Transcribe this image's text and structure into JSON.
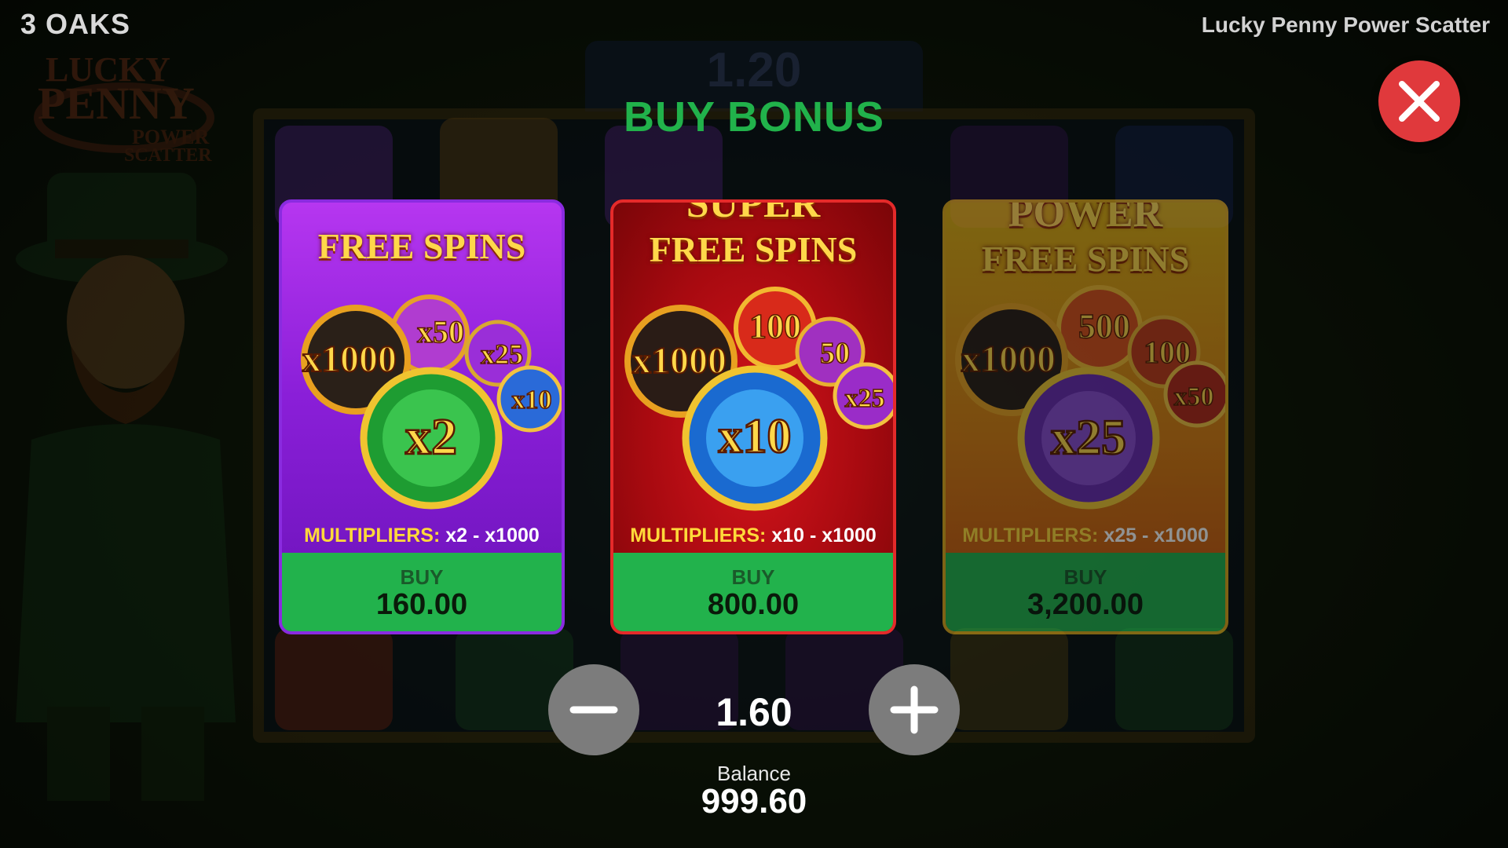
{
  "header": {
    "brand": "3 OAKS",
    "game_title": "Lucky Penny Power Scatter"
  },
  "background": {
    "bet_display": "1.20",
    "logo_text": [
      "LUCKY",
      "PENNY",
      "POWER",
      "SCATTER"
    ]
  },
  "modal": {
    "title": "BUY BONUS",
    "close_icon": "close-icon"
  },
  "cards": [
    {
      "title_lines": [
        "FREE SPINS"
      ],
      "coins": [
        "x1000",
        "x50",
        "x25",
        "x10",
        "x2"
      ],
      "multipliers_label": "MULTIPLIERS:",
      "multipliers_range": "x2 - x1000",
      "buy_label": "BUY",
      "price": "160.00",
      "enabled": true
    },
    {
      "title_lines": [
        "SUPER",
        "FREE SPINS"
      ],
      "coins": [
        "x1000",
        "100",
        "50",
        "x25",
        "x10"
      ],
      "multipliers_label": "MULTIPLIERS:",
      "multipliers_range": "x10 - x1000",
      "buy_label": "BUY",
      "price": "800.00",
      "enabled": true
    },
    {
      "title_lines": [
        "POWER",
        "FREE SPINS"
      ],
      "coins": [
        "x1000",
        "500",
        "100",
        "x50",
        "x25"
      ],
      "multipliers_label": "MULTIPLIERS:",
      "multipliers_range": "x25 - x1000",
      "buy_label": "BUY",
      "price": "3,200.00",
      "enabled": false
    }
  ],
  "controls": {
    "decrease_icon": "minus-icon",
    "increase_icon": "plus-icon",
    "bet": "1.60",
    "balance_label": "Balance",
    "balance": "999.60"
  },
  "colors": {
    "title_green": "#21b24b",
    "buy_green": "#22b24c",
    "close_red": "#e0393c",
    "card_purple": "#8a1fd8",
    "card_red": "#a80a10",
    "card_orange": "#d87c10"
  }
}
